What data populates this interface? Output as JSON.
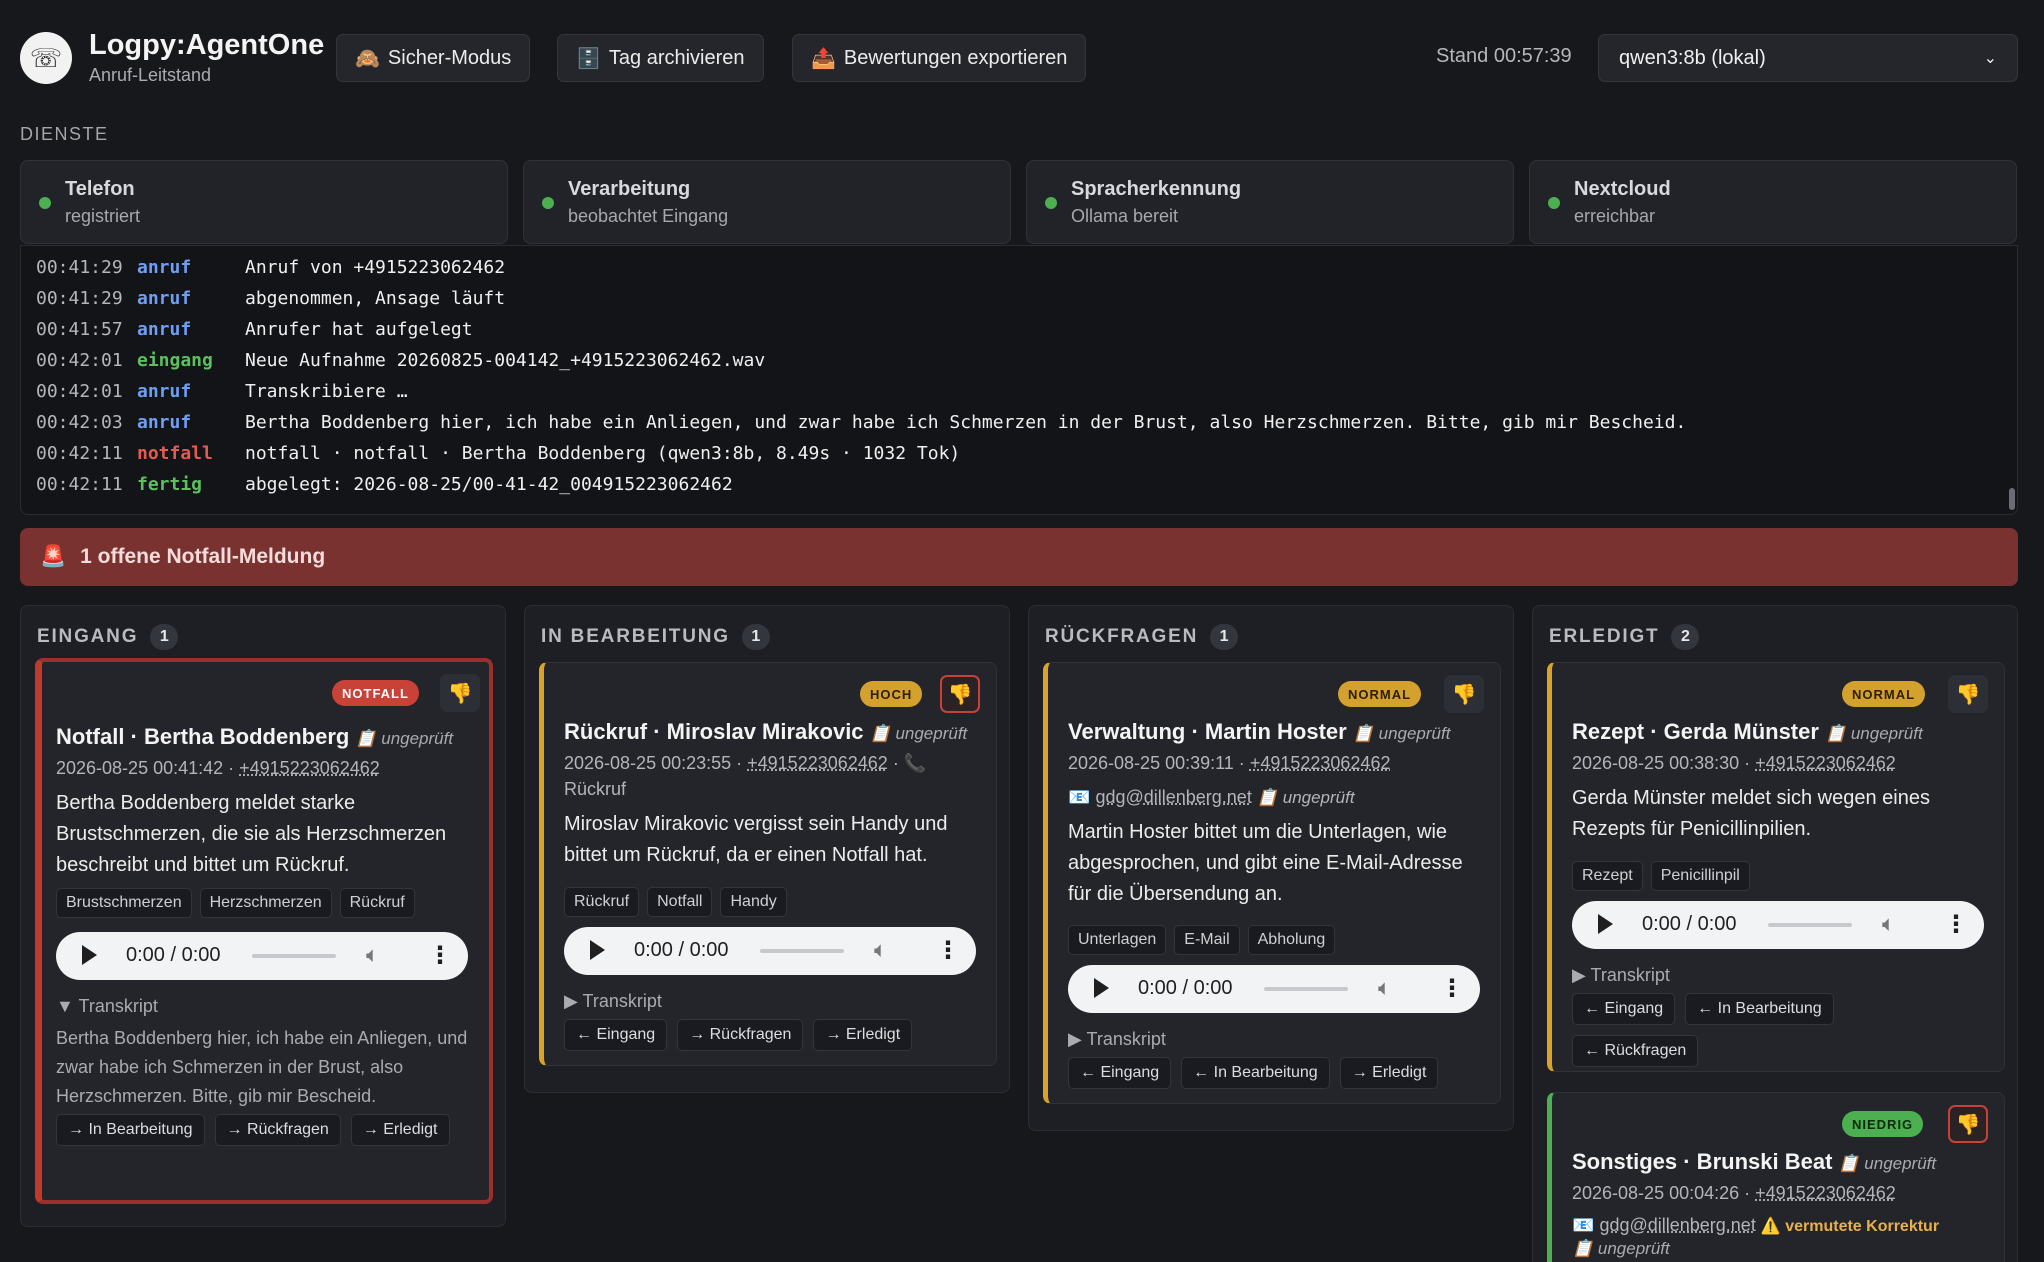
{
  "header": {
    "logo_icon": "phone-agent-icon",
    "title": "Logpy:AgentOne",
    "subtitle": "Anruf-Leitstand",
    "buttons": {
      "safe_mode": "Sicher-Modus",
      "archive_day": "Tag archivieren",
      "export_ratings": "Bewertungen exportieren"
    },
    "stand": "Stand 00:57:39",
    "model": "qwen3:8b (lokal)"
  },
  "services": {
    "label": "DIENSTE",
    "items": [
      {
        "name": "Telefon",
        "state": "registriert"
      },
      {
        "name": "Verarbeitung",
        "state": "beobachtet Eingang"
      },
      {
        "name": "Spracherkennung",
        "state": "Ollama bereit"
      },
      {
        "name": "Nextcloud",
        "state": "erreichbar"
      }
    ],
    "status_color": "#4caf50"
  },
  "log": [
    {
      "time": "00:41:29",
      "kind": "anruf",
      "msg": "Anruf von +4915223062462"
    },
    {
      "time": "00:41:29",
      "kind": "anruf",
      "msg": "abgenommen, Ansage läuft"
    },
    {
      "time": "00:41:57",
      "kind": "anruf",
      "msg": "Anrufer hat aufgelegt"
    },
    {
      "time": "00:42:01",
      "kind": "eingang",
      "msg": "Neue Aufnahme 20260825-004142_+4915223062462.wav"
    },
    {
      "time": "00:42:01",
      "kind": "anruf",
      "msg": "Transkribiere …"
    },
    {
      "time": "00:42:03",
      "kind": "anruf",
      "msg": "Bertha Boddenberg hier, ich habe ein Anliegen, und zwar habe ich Schmerzen in der Brust, also Herzschmerzen. Bitte, gib mir Bescheid."
    },
    {
      "time": "00:42:11",
      "kind": "notfall",
      "msg": "notfall · notfall · Bertha Boddenberg (qwen3:8b, 8.49s · 1032 Tok)"
    },
    {
      "time": "00:42:11",
      "kind": "fertig",
      "msg": "abgelegt: 2026-08-25/00-41-42_004915223062462"
    }
  ],
  "alert": {
    "icon": "siren-icon",
    "text": "1 offene Notfall-Meldung",
    "color": "#7a3230"
  },
  "common": {
    "unchecked": "ungeprüft",
    "transkript": "Transkript",
    "audio_time": "0:00 / 0:00",
    "thumb_icon": "thumbs-down-icon"
  },
  "columns": [
    {
      "title": "EINGANG",
      "count": "1",
      "cards": [
        {
          "badge": "NOTFALL",
          "title": "Notfall · Bertha Boddenberg",
          "date": "2026-08-25 00:41:42 · ",
          "phone": "+4915223062462",
          "body": "Bertha Boddenberg meldet starke Brustschmerzen, die sie als Herzschmerzen beschreibt und bittet um Rückruf.",
          "tags": [
            "Brustschmerzen",
            "Herzschmerzen",
            "Rückruf"
          ],
          "transcript": "Bertha Boddenberg hier, ich habe ein Anliegen, und zwar habe ich Schmerzen in der Brust, also Herzschmerzen. Bitte, gib mir Bescheid.",
          "moves": [
            "→ In Bearbeitung",
            "→ Rückfragen",
            "→ Erledigt"
          ]
        }
      ]
    },
    {
      "title": "IN BEARBEITUNG",
      "count": "1",
      "cards": [
        {
          "badge": "HOCH",
          "title": "Rückruf · Miroslav Mirakovic",
          "date": "2026-08-25 00:23:55 · ",
          "phone": "+4915223062462",
          "callback": "· 📞",
          "callback_label": "Rückruf",
          "body": "Miroslav Mirakovic vergisst sein Handy und bittet um Rückruf, da er einen Notfall hat.",
          "tags": [
            "Rückruf",
            "Notfall",
            "Handy"
          ],
          "moves": [
            "← Eingang",
            "→ Rückfragen",
            "→ Erledigt"
          ]
        }
      ]
    },
    {
      "title": "RÜCKFRAGEN",
      "count": "1",
      "cards": [
        {
          "badge": "NORMAL",
          "title": "Verwaltung · Martin Hoster",
          "date": "2026-08-25 00:39:11 · ",
          "phone": "+4915223062462",
          "email": "gdg@dillenberg.net",
          "body": "Martin Hoster bittet um die Unterlagen, wie abgesprochen, und gibt eine E-Mail-Adresse für die Übersendung an.",
          "tags": [
            "Unterlagen",
            "E-Mail",
            "Abholung"
          ],
          "moves": [
            "← Eingang",
            "← In Bearbeitung",
            "→ Erledigt"
          ]
        }
      ]
    },
    {
      "title": "ERLEDIGT",
      "count": "2",
      "cards": [
        {
          "badge": "NORMAL",
          "title": "Rezept · Gerda Münster",
          "date": "2026-08-25 00:38:30 · ",
          "phone": "+4915223062462",
          "body": "Gerda Münster meldet sich wegen eines Rezepts für Penicillinpilien.",
          "tags": [
            "Rezept",
            "Penicillinpil"
          ],
          "moves": [
            "← Eingang",
            "← In Bearbeitung",
            "← Rückfragen"
          ]
        },
        {
          "badge": "NIEDRIG",
          "title": "Sonstiges · Brunski Beat",
          "date": "2026-08-25 00:04:26 · ",
          "phone": "+4915223062462",
          "email": "gdg@dillenberg.net",
          "warning": "⚠️ vermutete Korrektur"
        }
      ]
    }
  ]
}
